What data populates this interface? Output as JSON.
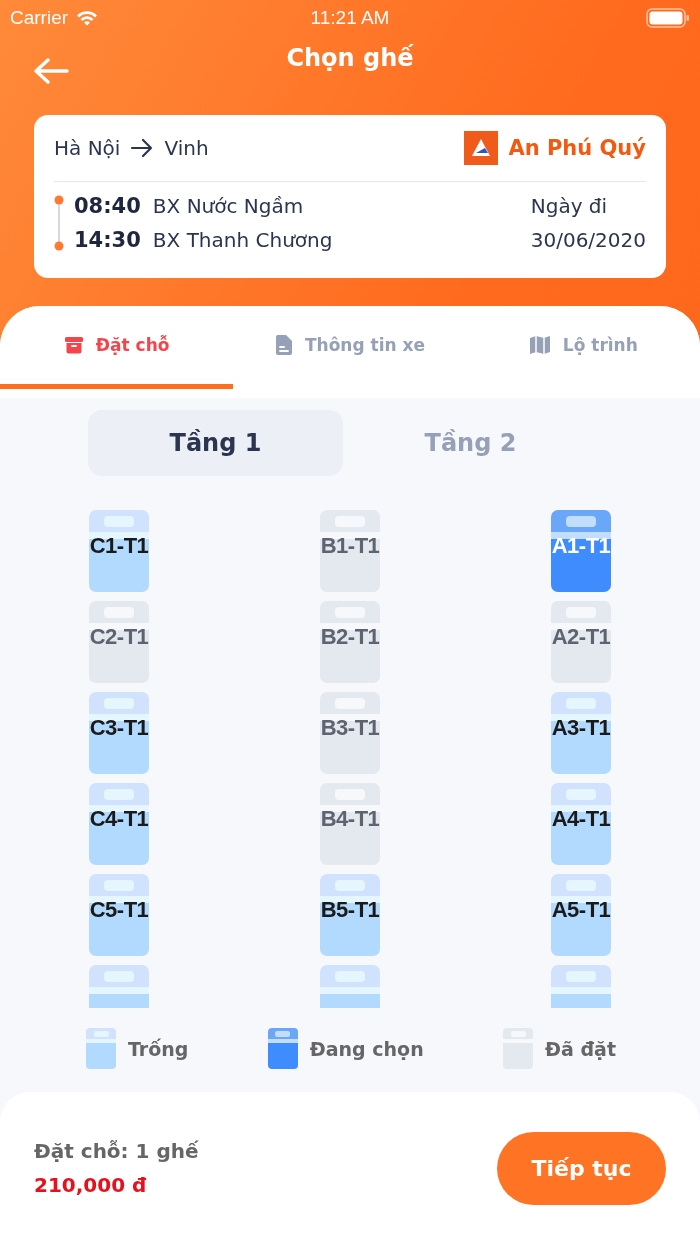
{
  "status_bar": {
    "carrier": "Carrier",
    "time": "11:21 AM"
  },
  "header": {
    "title": "Chọn ghế"
  },
  "trip": {
    "from": "Hà Nội",
    "to": "Vinh",
    "operator": "An Phú Quý",
    "depart_time": "08:40",
    "depart_station": "BX Nước Ngầm",
    "arrive_time": "14:30",
    "arrive_station": "BX Thanh Chương",
    "date_label": "Ngày đi",
    "date": "30/06/2020"
  },
  "tabs": [
    {
      "label": "Đặt chỗ",
      "selected": true
    },
    {
      "label": "Thông tin xe",
      "selected": false
    },
    {
      "label": "Lộ trình",
      "selected": false
    }
  ],
  "floors": [
    {
      "label": "Tầng 1",
      "selected": true
    },
    {
      "label": "Tầng 2",
      "selected": false
    }
  ],
  "seat_rows": [
    [
      {
        "label": "C1-T1",
        "booked": false,
        "selected": false
      },
      {
        "label": "B1-T1",
        "booked": true,
        "selected": false
      },
      {
        "label": "A1-T1",
        "booked": false,
        "selected": true
      }
    ],
    [
      {
        "label": "C2-T1",
        "booked": true,
        "selected": false
      },
      {
        "label": "B2-T1",
        "booked": true,
        "selected": false
      },
      {
        "label": "A2-T1",
        "booked": true,
        "selected": false
      }
    ],
    [
      {
        "label": "C3-T1",
        "booked": false,
        "selected": false
      },
      {
        "label": "B3-T1",
        "booked": true,
        "selected": false
      },
      {
        "label": "A3-T1",
        "booked": false,
        "selected": false
      }
    ],
    [
      {
        "label": "C4-T1",
        "booked": false,
        "selected": false
      },
      {
        "label": "B4-T1",
        "booked": true,
        "selected": false
      },
      {
        "label": "A4-T1",
        "booked": false,
        "selected": false
      }
    ],
    [
      {
        "label": "C5-T1",
        "booked": false,
        "selected": false
      },
      {
        "label": "B5-T1",
        "booked": false,
        "selected": false
      },
      {
        "label": "A5-T1",
        "booked": false,
        "selected": false
      }
    ],
    [
      {
        "booked": false,
        "selected": false
      },
      {
        "booked": false,
        "selected": false
      },
      {
        "booked": false,
        "selected": false
      }
    ]
  ],
  "legend": [
    {
      "label": "Trống",
      "kind": "available"
    },
    {
      "label": "Đang chọn",
      "kind": "selected"
    },
    {
      "label": "Đã đặt",
      "kind": "booked"
    }
  ],
  "summary": {
    "count": "Đặt chỗ: 1 ghế",
    "price": "210,000 đ",
    "button": "Tiếp tục"
  }
}
